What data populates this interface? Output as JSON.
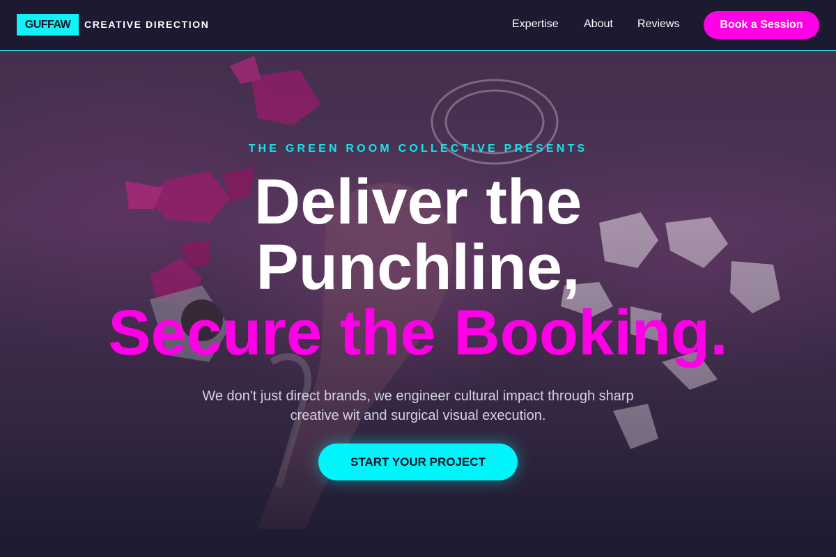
{
  "header": {
    "logo_text": "GUFFAW",
    "logo_subtitle": "CREATIVE DIRECTION",
    "nav": [
      {
        "label": "Expertise"
      },
      {
        "label": "About"
      },
      {
        "label": "Reviews"
      }
    ],
    "cta_label": "Book a Session"
  },
  "hero": {
    "eyebrow": "THE GREEN ROOM COLLECTIVE PRESENTS",
    "headline_line1": "Deliver the",
    "headline_line2": "Punchline,",
    "headline_line3": "Secure the Booking.",
    "subtitle": "We don't just direct brands, we engineer cultural impact through sharp creative wit and surgical visual execution.",
    "cta_label": "START YOUR PROJECT"
  },
  "colors": {
    "accent_cyan": "#00f5fb",
    "accent_pink": "#ff00e6",
    "header_bg": "#1c1a30"
  }
}
